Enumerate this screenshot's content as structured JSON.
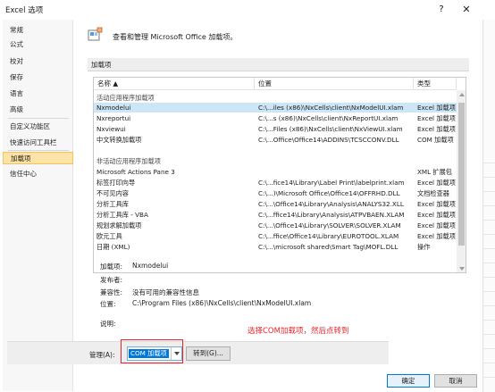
{
  "window": {
    "title": "Excel 选项",
    "help_label": "?",
    "close_label": "✕"
  },
  "sidebar": {
    "items": [
      {
        "label": "常规"
      },
      {
        "label": "公式"
      },
      {
        "label": "校对"
      },
      {
        "label": "保存"
      },
      {
        "label": "语言"
      },
      {
        "label": "高级"
      },
      {
        "label": "自定义功能区"
      },
      {
        "label": "快速访问工具栏"
      },
      {
        "label": "加载项",
        "active": true
      },
      {
        "label": "信任中心"
      }
    ]
  },
  "header": {
    "title": "查看和管理 Microsoft Office 加载项。",
    "icon": "addins-icon"
  },
  "section": {
    "title": "加载项"
  },
  "table": {
    "columns": [
      "名称 ▲",
      "位置",
      "类型"
    ],
    "active_group_title": "活动应用程序加载项",
    "active_rows": [
      {
        "name": "Nxmodelui",
        "location": "C:\\...iles (x86)\\NxCells\\client\\NxModelUI.xlam",
        "type": "Excel 加载项"
      },
      {
        "name": "Nxreportui",
        "location": "C:\\...s (x86)\\NxCells\\client\\NxReportUI.xlam",
        "type": "Excel 加载项"
      },
      {
        "name": "Nxviewui",
        "location": "C:\\...Files (x86)\\NxCells\\client\\NxViewUI.xlam",
        "type": "Excel 加载项"
      },
      {
        "name": "中文转换加载项",
        "location": "C:\\...Office\\Office14\\ADDINS\\TCSCCONV.DLL",
        "type": "COM 加载项"
      }
    ],
    "inactive_group_title": "非活动应用程序加载项",
    "inactive_rows": [
      {
        "name": "Microsoft Actions Pane 3",
        "location": "",
        "type": "XML 扩展包"
      },
      {
        "name": "标签打印向导",
        "location": "C:\\...fice14\\Library\\Label Print\\labelprint.xlam",
        "type": "Excel 加载项"
      },
      {
        "name": "不可见内容",
        "location": "C:\\...)\\Microsoft Office\\Office14\\OFFRHD.DLL",
        "type": "文档检查器"
      },
      {
        "name": "分析工具库",
        "location": "C:\\...\\Office14\\Library\\Analysis\\ANALYS32.XLL",
        "type": "Excel 加载项"
      },
      {
        "name": "分析工具库 - VBA",
        "location": "C:\\...ffice14\\Library\\Analysis\\ATPVBAEN.XLAM",
        "type": "Excel 加载项"
      },
      {
        "name": "规划求解加载项",
        "location": "C:\\...\\Office14\\Library\\SOLVER\\SOLVER.XLAM",
        "type": "Excel 加载项"
      },
      {
        "name": "欧元工具",
        "location": "C:\\...ffice\\Office14\\Library\\EUROTOOL.XLAM",
        "type": "Excel 加载项"
      },
      {
        "name": "日期 (XML)",
        "location": "C:\\...\\microsoft shared\\Smart Tag\\MOFL.DLL",
        "type": "操作"
      }
    ]
  },
  "details": {
    "addin_label": "加载项:",
    "addin_value": "Nxmodelui",
    "publisher_label": "发布者:",
    "publisher_value": "",
    "compat_label": "兼容性:",
    "compat_value": "没有可用的兼容性信息",
    "location_label": "位置:",
    "location_value": "C:\\Program Files (x86)\\NxCells\\client\\NxModelUI.xlam",
    "desc_label": "说明:",
    "desc_value": ""
  },
  "annotation": {
    "text": "选择COM加载项，然后点转到",
    "color": "#e8242a"
  },
  "manage": {
    "label": "管理(A):",
    "selected": "COM 加载项",
    "go_label": "转到(G)..."
  },
  "footer": {
    "ok_label": "确定",
    "cancel_label": "取消"
  },
  "colors": {
    "selection": "#cde6f7",
    "active_nav": "#fde3a8",
    "accent": "#0078d7"
  }
}
